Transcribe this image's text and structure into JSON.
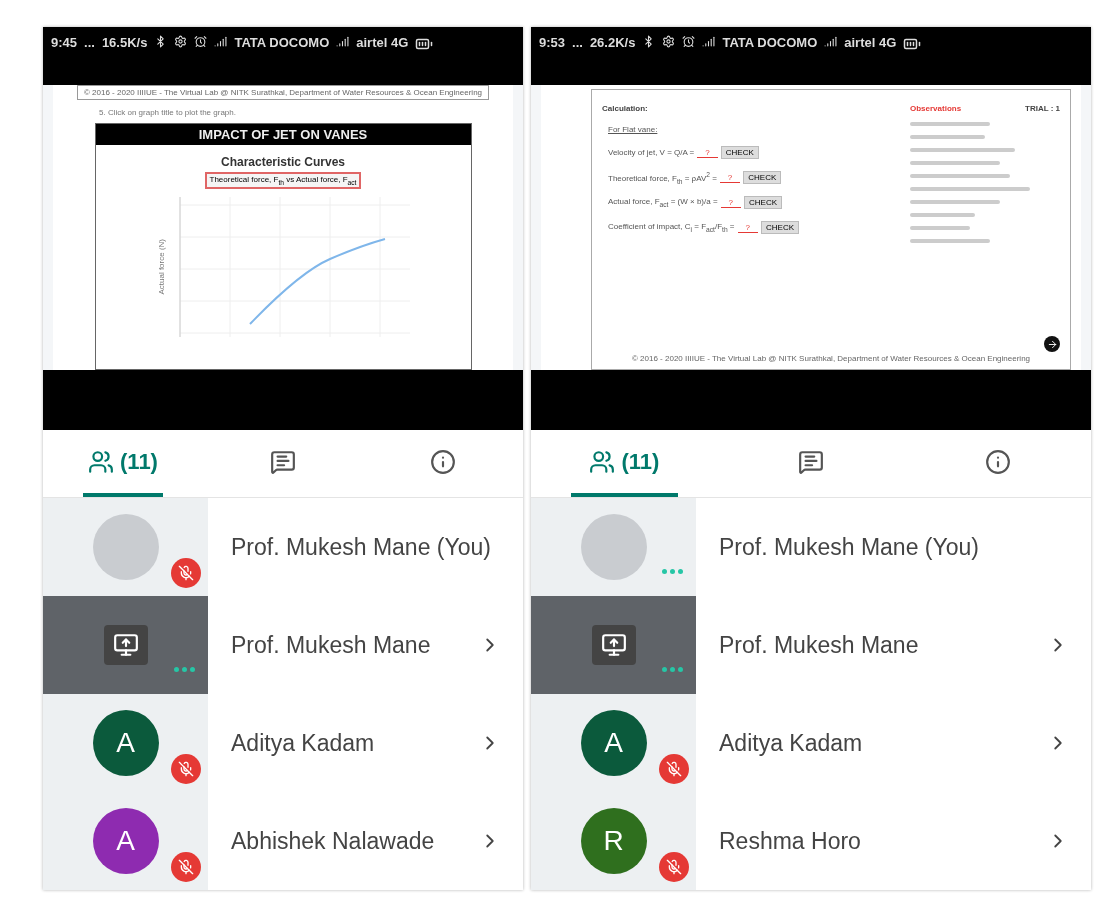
{
  "phones": [
    {
      "status_bar": {
        "time": "9:45",
        "dots": "...",
        "speed": "16.5K/s",
        "carrier_1": "TATA DOCOMO",
        "carrier_2": "airtel 4G"
      },
      "web_page": {
        "kind": "graph",
        "footer": "© 2016 - 2020 IIIIUE - The Virtual Lab @ NITK Surathkal, Department of Water Resources & Ocean Engineering",
        "step": "5. Click on graph title to plot the graph.",
        "banner": "IMPACT OF JET ON VANES",
        "chart_title": "Characteristic Curves",
        "graph_button": "Theoretical force, F$_{th}$ vs Actual force, F$_{act}$",
        "ylabel": "Actual force (N)"
      },
      "tabs": [
        {
          "kind": "people",
          "label": "(11)",
          "selected": true
        },
        {
          "kind": "chat",
          "selected": false
        },
        {
          "kind": "info",
          "selected": false
        }
      ],
      "participants": [
        {
          "kind": "photo",
          "name": "Prof. Mukesh Mane (You)",
          "muted": true,
          "chevron": false
        },
        {
          "kind": "screen",
          "name": "Prof. Mukesh Mane",
          "muted": false,
          "chevron": true
        },
        {
          "kind": "letter",
          "name": "Aditya Kadam",
          "letter": "A",
          "color": "#0b5a3c",
          "muted": true,
          "chevron": true
        },
        {
          "kind": "letter",
          "name": "Abhishek Nalawade",
          "letter": "A",
          "color": "#8e2bb0",
          "muted": true,
          "chevron": true
        }
      ]
    },
    {
      "status_bar": {
        "time": "9:53",
        "dots": "...",
        "speed": "26.2K/s",
        "carrier_1": "TATA DOCOMO",
        "carrier_2": "airtel 4G"
      },
      "web_page": {
        "kind": "calculation",
        "calc_title": "Calculation:",
        "obs_title": "Observations",
        "trial": "TRIAL : 1",
        "subtitle": "For Flat vane:",
        "rows": [
          {
            "label": "Velocity of jet, V = Q/A =",
            "answer": "?",
            "button": "CHECK"
          },
          {
            "label": "Theoretical force, F$_{th}$ = ρAV$^{2}$ =",
            "answer": "?",
            "button": "CHECK"
          },
          {
            "label": "Actual force, F$_{act}$ = (W × b)/a =",
            "answer": "?",
            "button": "CHECK"
          },
          {
            "label": "Coefficient of impact, C$_{i}$ = F$_{act}$/F$_{th}$ =",
            "answer": "?",
            "button": "CHECK"
          }
        ],
        "footer": "© 2016 - 2020 IIIIUE - The Virtual Lab @ NITK Surathkal, Department of Water Resources & Ocean Engineering"
      },
      "tabs": [
        {
          "kind": "people",
          "label": "(11)",
          "selected": true
        },
        {
          "kind": "chat",
          "selected": false
        },
        {
          "kind": "info",
          "selected": false
        }
      ],
      "participants": [
        {
          "kind": "photo",
          "name": "Prof. Mukesh Mane (You)",
          "muted": false,
          "chevron": false
        },
        {
          "kind": "screen",
          "name": "Prof. Mukesh Mane",
          "muted": false,
          "chevron": true
        },
        {
          "kind": "letter",
          "name": "Aditya Kadam",
          "letter": "A",
          "color": "#0b5a3c",
          "muted": true,
          "chevron": true
        },
        {
          "kind": "letter",
          "name": "Reshma Horo",
          "letter": "R",
          "color": "#2f6f1e",
          "muted": true,
          "chevron": true
        }
      ]
    }
  ]
}
